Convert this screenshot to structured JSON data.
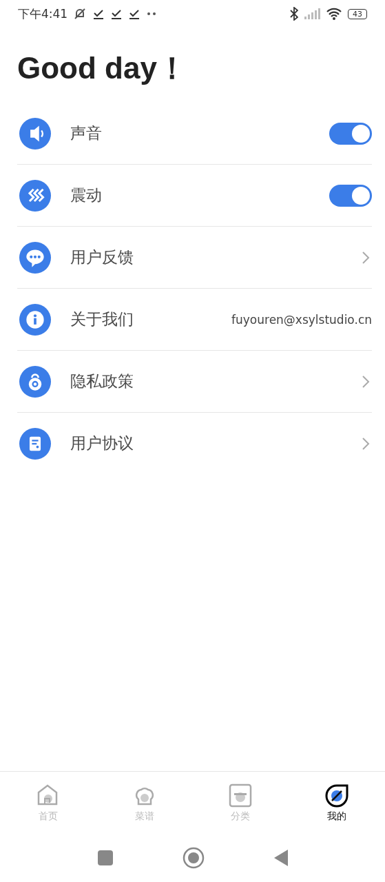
{
  "status_bar": {
    "time": "下午4:41",
    "battery": "43"
  },
  "title": "Good day！",
  "settings": [
    {
      "kind": "toggle",
      "label": "声音",
      "on": true
    },
    {
      "kind": "toggle",
      "label": "震动",
      "on": true
    },
    {
      "kind": "link",
      "label": "用户反馈"
    },
    {
      "kind": "info",
      "label": "关于我们",
      "value": "fuyouren@xsylstudio.cn"
    },
    {
      "kind": "link",
      "label": "隐私政策"
    },
    {
      "kind": "link",
      "label": "用户协议"
    }
  ],
  "tabs": [
    {
      "label": "首页",
      "selected": false
    },
    {
      "label": "菜谱",
      "selected": false
    },
    {
      "label": "分类",
      "selected": false
    },
    {
      "label": "我的",
      "selected": true
    }
  ]
}
